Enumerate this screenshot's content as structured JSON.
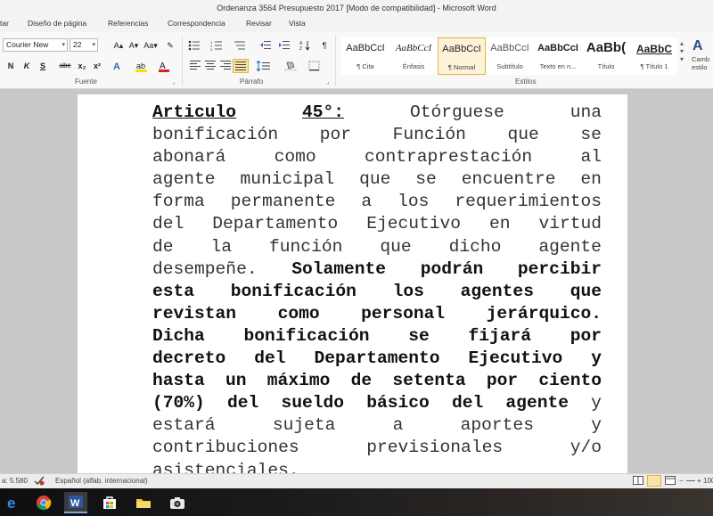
{
  "window": {
    "title": "Ordenanza 3564 Presupuesto 2017 [Modo de compatibilidad]  -  Microsoft Word"
  },
  "menu": {
    "tabs": [
      "tar",
      "Diseño de página",
      "Referencias",
      "Correspondencia",
      "Revisar",
      "Vista"
    ]
  },
  "ribbon": {
    "font": {
      "name": "Courier New",
      "size": "22",
      "group_label": "Fuente"
    },
    "paragraph": {
      "group_label": "Párrafo"
    },
    "styles": {
      "group_label": "Estilos",
      "items": [
        {
          "sample": "AaBbCcI",
          "name": "¶ Cita"
        },
        {
          "sample": "AaBbCcI",
          "name": "Énfasis"
        },
        {
          "sample": "AaBbCcI",
          "name": "¶ Normal"
        },
        {
          "sample": "AaBbCcI",
          "name": "Subtítulo"
        },
        {
          "sample": "AaBbCcI",
          "name": "Texto en n..."
        },
        {
          "sample": "AaBb(",
          "name": "Título"
        },
        {
          "sample": "AaBbC",
          "name": "¶ Título 1"
        }
      ],
      "change_label": "Camb estilo"
    },
    "font_buttons": [
      "N",
      "K",
      "S",
      "abc",
      "x₂",
      "x²",
      "A"
    ],
    "size_buttons": [
      "A▴",
      "A▾",
      "Aa▾",
      "✎"
    ]
  },
  "document": {
    "lines": [
      [
        "Articulo",
        "45°:",
        "Otórguese",
        "una"
      ],
      [
        "bonificación",
        "por",
        "Función",
        "que",
        "se"
      ],
      [
        "abonará",
        "como",
        "contraprestación",
        "al"
      ],
      [
        "agente",
        "municipal",
        "que",
        "se",
        "encuentre",
        "en"
      ],
      [
        "forma",
        "permanente",
        "a",
        "los",
        "requerimientos"
      ],
      [
        "del",
        "Departamento",
        "Ejecutivo",
        "en",
        "virtud"
      ],
      [
        "de",
        "la",
        "función",
        "que",
        "dicho",
        "agente"
      ],
      [
        "desempeñe.",
        "Solamente",
        "podrán",
        "percibir"
      ],
      [
        "esta",
        "bonificación",
        "los",
        "agentes",
        "que"
      ],
      [
        "revistan",
        "como",
        "personal",
        "jerárquico."
      ],
      [
        "Dicha",
        "bonificación",
        "se",
        "fijará",
        "por"
      ],
      [
        "decreto",
        "del",
        "Departamento",
        "Ejecutivo",
        "y"
      ],
      [
        "hasta",
        "un",
        "máximo",
        "de",
        "setenta",
        "por",
        "ciento"
      ],
      [
        "(70%)",
        "del",
        "sueldo",
        "básico",
        "del",
        "agente",
        "y"
      ],
      [
        "estará",
        "sujeta",
        "a",
        "aportes",
        "y"
      ],
      [
        "contribuciones",
        "previsionales",
        "y/o"
      ],
      [
        "asistenciales."
      ]
    ]
  },
  "status": {
    "page_info": "a: 5.580",
    "language": "Español (alfab. internacional)",
    "zoom": "100"
  },
  "taskbar": {
    "icons": [
      "edge-icon",
      "chrome-icon",
      "word-icon",
      "store-icon",
      "file-explorer-icon",
      "camera-icon"
    ]
  }
}
